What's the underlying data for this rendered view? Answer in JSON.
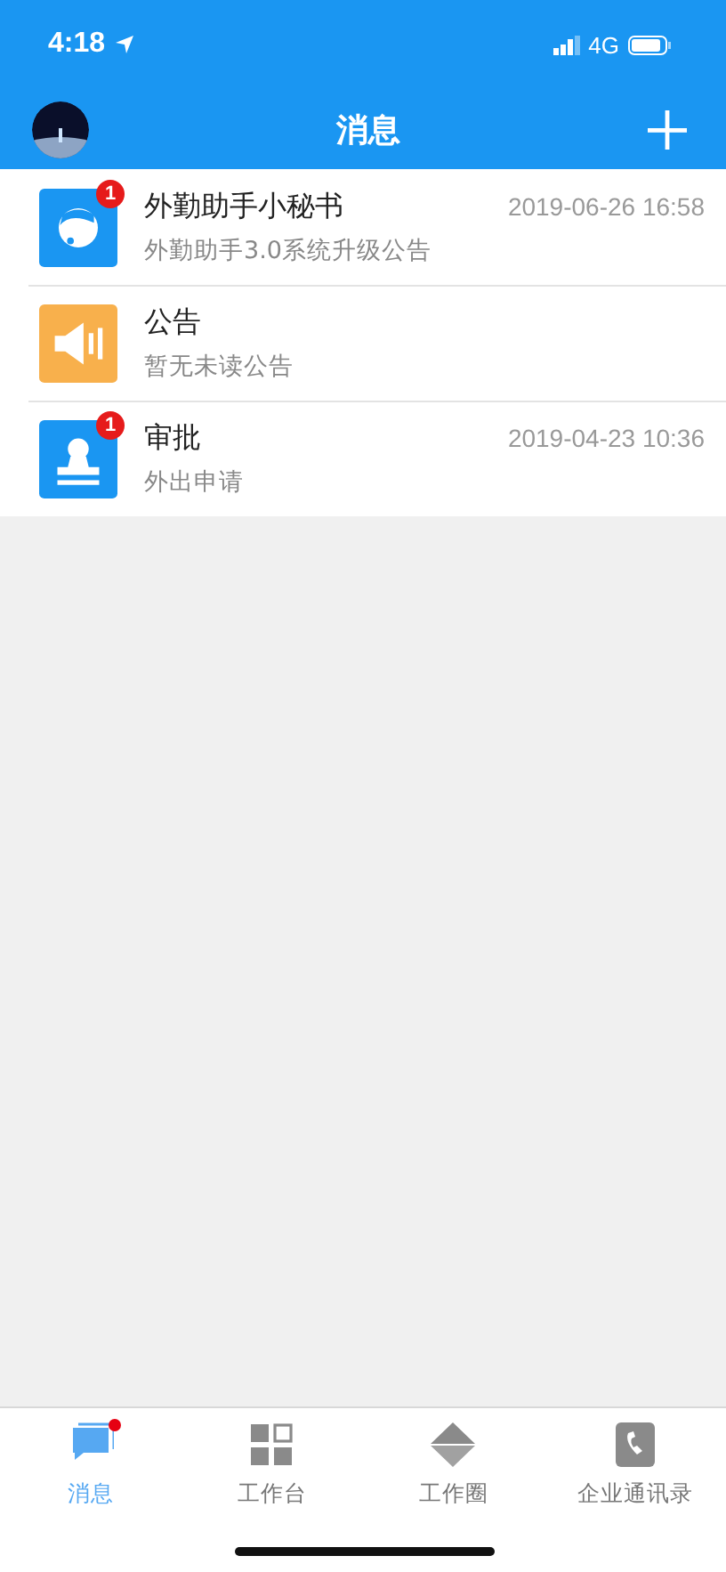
{
  "status_bar": {
    "time": "4:18",
    "network": "4G"
  },
  "nav": {
    "title": "消息"
  },
  "messages": [
    {
      "kind": "assistant",
      "title": "外勤助手小秘书",
      "time": "2019-06-26 16:58",
      "preview": "外勤助手3.0系统升级公告",
      "badge": "1"
    },
    {
      "kind": "announcement",
      "title": "公告",
      "preview": "暂无未读公告"
    },
    {
      "kind": "approval",
      "title": "审批",
      "time": "2019-04-23 10:36",
      "preview": "外出申请",
      "badge": "1"
    }
  ],
  "tabs": [
    {
      "kind": "messages",
      "label": "消息",
      "selected": true,
      "dot": true
    },
    {
      "kind": "workbench",
      "label": "工作台",
      "selected": false,
      "dot": false
    },
    {
      "kind": "circle",
      "label": "工作圈",
      "selected": false,
      "dot": false
    },
    {
      "kind": "contacts",
      "label": "企业通讯录",
      "selected": false,
      "dot": false
    }
  ]
}
